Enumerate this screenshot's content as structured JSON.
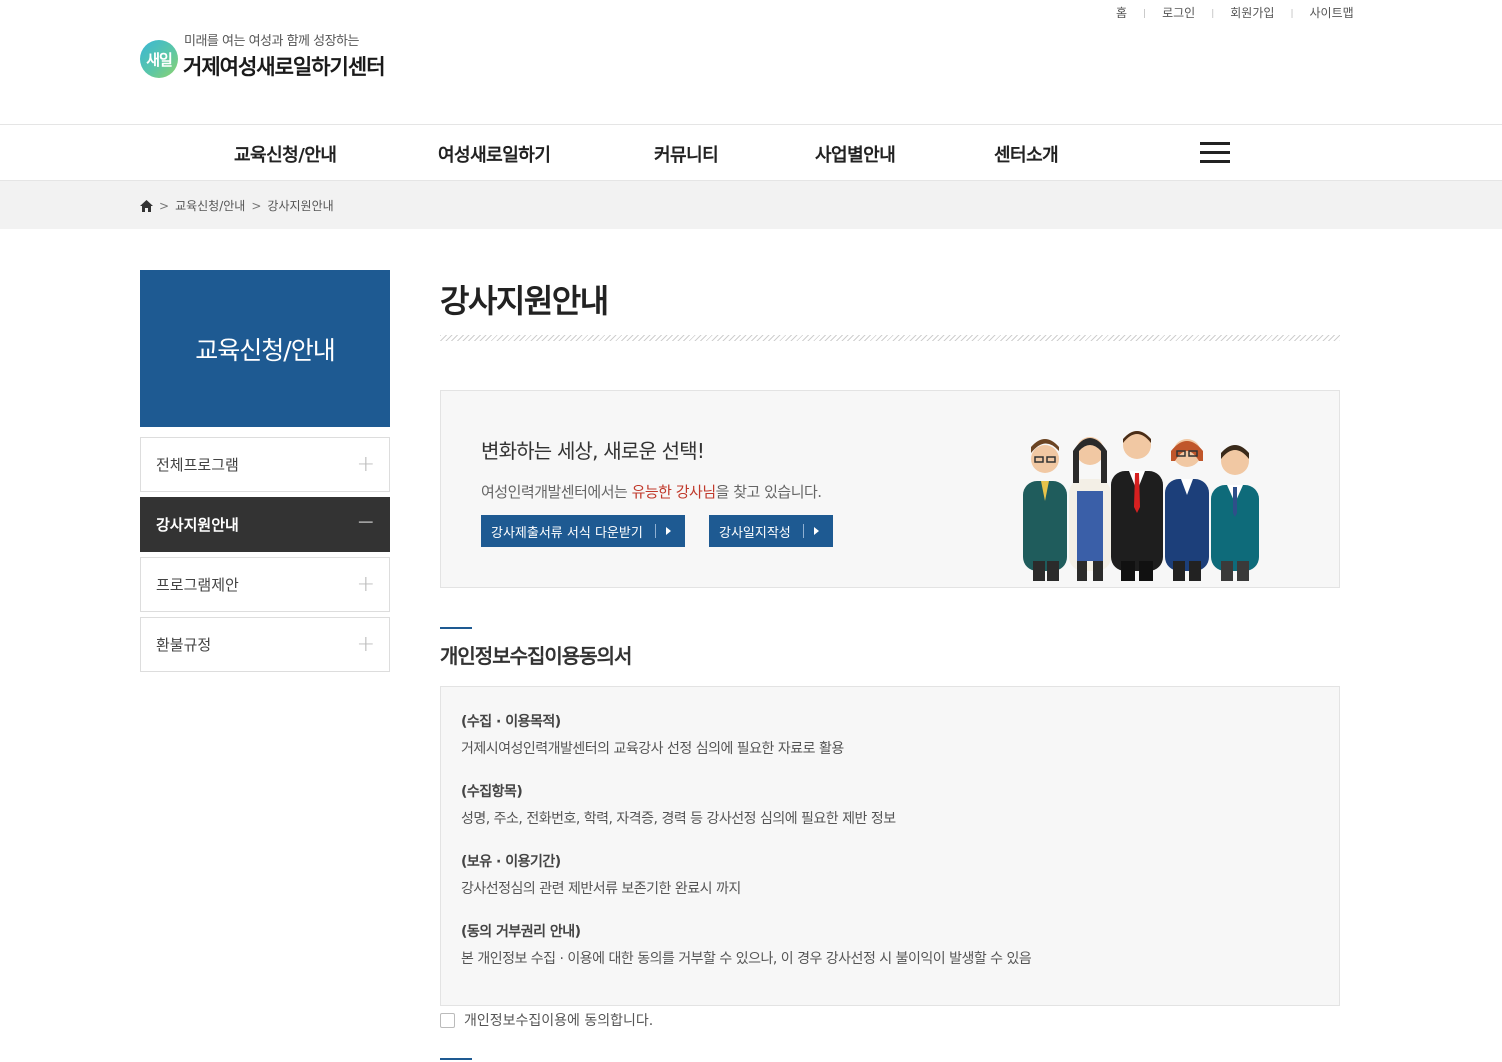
{
  "util_links": [
    "홈",
    "로그인",
    "회원가입",
    "사이트맵"
  ],
  "logo": {
    "mark": "새일",
    "sub": "미래를 여는 여성과 함께 성장하는",
    "main": "거제여성새로일하기센터"
  },
  "gnb": [
    "교육신청/안내",
    "여성새로일하기",
    "커뮤니티",
    "사업별안내",
    "센터소개"
  ],
  "breadcrumb": [
    "교육신청/안내",
    "강사지원안내"
  ],
  "side": {
    "title": "교육신청/안내",
    "items": [
      {
        "label": "전체프로그램",
        "sign": "+"
      },
      {
        "label": "강사지원안내",
        "sign": "−"
      },
      {
        "label": "프로그램제안",
        "sign": "+"
      },
      {
        "label": "환불규정",
        "sign": "+"
      }
    ]
  },
  "page_title": "강사지원안내",
  "promo": {
    "headline": "변화하는 세상, 새로운 선택!",
    "desc_pre": "여성인력개발센터에서는 ",
    "desc_highlight": "유능한 강사님",
    "desc_post": "을 찾고 있습니다.",
    "button_download": "강사제출서류 서식 다운받기",
    "button_write": "강사일지작성"
  },
  "section_title": "개인정보수집이용동의서",
  "agreement": [
    {
      "heading": "(수집 · 이용목적)",
      "text": "거제시여성인력개발센터의 교육강사 선정 심의에 필요한 자료로 활용"
    },
    {
      "heading": "(수집항목)",
      "text": "성명, 주소, 전화번호, 학력, 자격증, 경력 등 강사선정 심의에 필요한 제반 정보"
    },
    {
      "heading": "(보유 · 이용기간)",
      "text": "강사선정심의 관련 제반서류 보존기한 완료시 까지"
    },
    {
      "heading": "(동의 거부권리 안내)",
      "text": "본 개인정보 수집 · 이용에 대한 동의를 거부할 수 있으나, 이 경우 강사선정 시 불이익이 발생할 수 있음"
    }
  ],
  "consent_label": "개인정보수집이용에 동의합니다.",
  "colors": {
    "brand": "#1e5a92",
    "active": "#333333",
    "highlight": "#c0392b"
  }
}
